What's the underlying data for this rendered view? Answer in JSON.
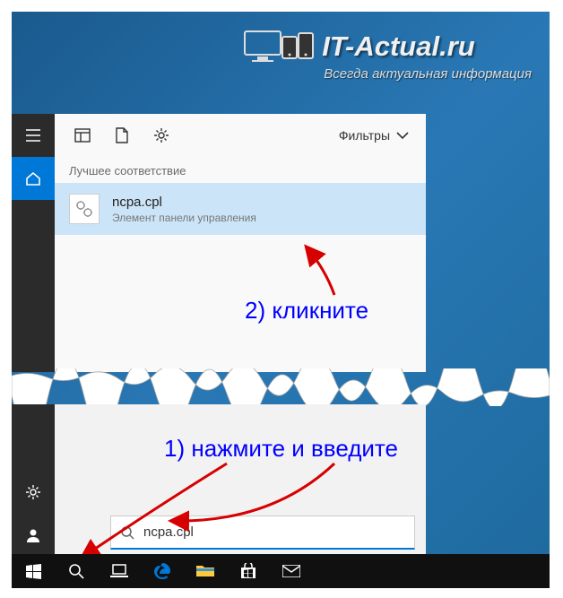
{
  "watermark": {
    "title": "IT-Actual.ru",
    "subtitle": "Всегда актуальная информация"
  },
  "toolbar": {
    "filters_label": "Фильтры"
  },
  "best_match_label": "Лучшее соответствие",
  "result": {
    "title": "ncpa.cpl",
    "subtitle": "Элемент панели управления"
  },
  "search": {
    "value": "ncpa.cpl",
    "placeholder": ""
  },
  "annotations": {
    "step2": "2) кликните",
    "step1": "1) нажмите и введите"
  },
  "icons": {
    "hamburger": "hamburger-icon",
    "home": "home-icon",
    "apps": "apps-icon",
    "document": "document-icon",
    "settings": "gear-icon",
    "chevron": "chevron-down-icon",
    "gear_rail": "gear-icon",
    "user": "user-icon",
    "search": "search-icon",
    "start": "windows-logo-icon",
    "taskview": "task-view-icon",
    "edge": "edge-icon",
    "explorer": "file-explorer-icon",
    "store": "store-icon",
    "mail": "mail-icon"
  }
}
